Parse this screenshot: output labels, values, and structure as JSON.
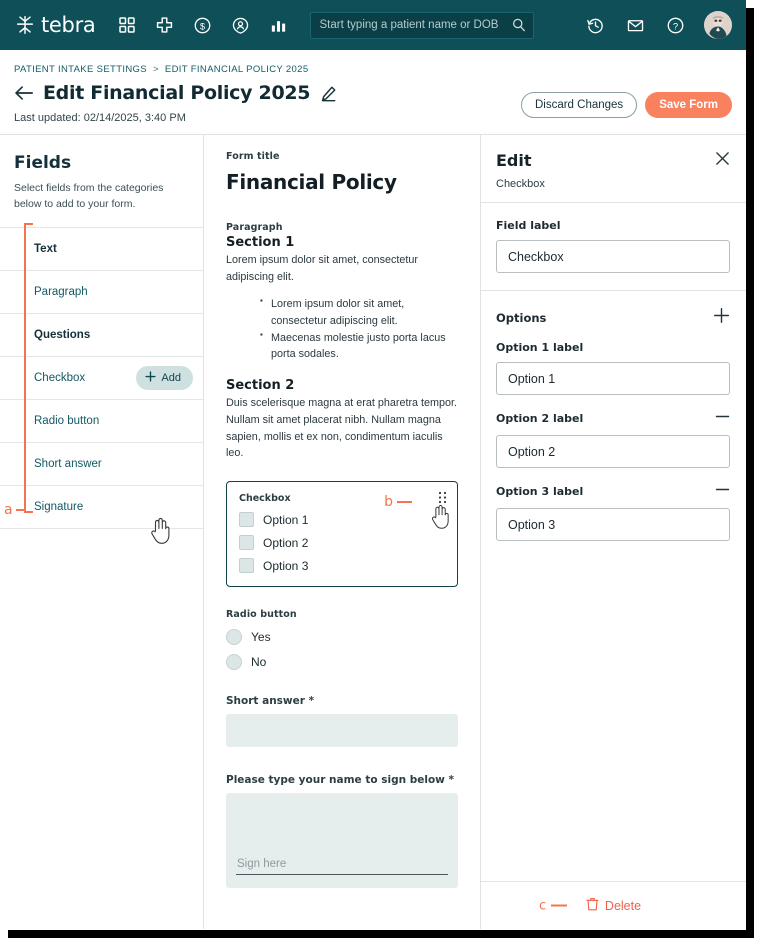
{
  "topnav": {
    "brand": "tebra",
    "icons": [
      "grid-icon",
      "plus-medical-icon",
      "dollar-circle-icon",
      "patient-location-icon",
      "bar-chart-icon"
    ],
    "search": {
      "placeholder": "Start typing a patient name or DOB",
      "value": ""
    },
    "right_icons": [
      "history-clock-icon",
      "mail-icon",
      "help-circle-icon"
    ],
    "avatar_name": "user-avatar"
  },
  "page_header": {
    "breadcrumb_root": "PATIENT INTAKE SETTINGS",
    "breadcrumb_sep": ">",
    "breadcrumb_current": "EDIT FINANCIAL POLICY 2025",
    "title": "Edit Financial Policy 2025",
    "last_updated": "Last updated: 02/14/2025, 3:40 PM",
    "discard_label": "Discard Changes",
    "save_label": "Save Form"
  },
  "sidebar": {
    "heading": "Fields",
    "subtext": "Select fields from the categories below to add to your form.",
    "rows": [
      {
        "label": "Text",
        "type": "category"
      },
      {
        "label": "Paragraph",
        "type": "item"
      },
      {
        "label": "Questions",
        "type": "category"
      },
      {
        "label": "Checkbox",
        "type": "item",
        "add_label": "Add"
      },
      {
        "label": "Radio button",
        "type": "item"
      },
      {
        "label": "Short answer",
        "type": "item"
      },
      {
        "label": "Signature",
        "type": "item"
      }
    ],
    "annotation_a": "a"
  },
  "canvas": {
    "form_title_label": "Form title",
    "form_title": "Financial Policy",
    "paragraph_label": "Paragraph",
    "section1_heading": "Section 1",
    "section1_text": "Lorem ipsum dolor sit amet, consectetur adipiscing elit.",
    "bullets": [
      "Lorem ipsum dolor sit amet, consectetur adipiscing elit.",
      "Maecenas molestie justo porta lacus porta sodales."
    ],
    "section2_heading": "Section 2",
    "section2_text": "Duis scelerisque magna at erat pharetra tempor. Nullam sit amet placerat nibh. Nullam magna sapien, mollis et ex non, condimentum iaculis leo.",
    "checkbox_field": {
      "label": "Checkbox",
      "options": [
        "Option 1",
        "Option 2",
        "Option 3"
      ]
    },
    "annotation_b": "b",
    "radio_field": {
      "label": "Radio button",
      "options": [
        "Yes",
        "No"
      ]
    },
    "short_answer": {
      "label": "Short answer *",
      "value": ""
    },
    "signature": {
      "label": "Please type your name to sign below *",
      "placeholder": "Sign here"
    }
  },
  "right_panel": {
    "title": "Edit",
    "subtitle": "Checkbox",
    "field_label_title": "Field label",
    "field_label_value": "Checkbox",
    "options_heading": "Options",
    "options": [
      {
        "label": "Option 1 label",
        "value": "Option 1"
      },
      {
        "label": "Option 2 label",
        "value": "Option 2"
      },
      {
        "label": "Option 3 label",
        "value": "Option 3"
      }
    ],
    "delete_label": "Delete",
    "annotation_c": "c"
  },
  "colors": {
    "nav_teal": "#0e4f58",
    "accent_orange": "#f9815e",
    "annotation_orange": "#f4744d",
    "delete_red": "#f4604a",
    "link_teal": "#125963"
  }
}
